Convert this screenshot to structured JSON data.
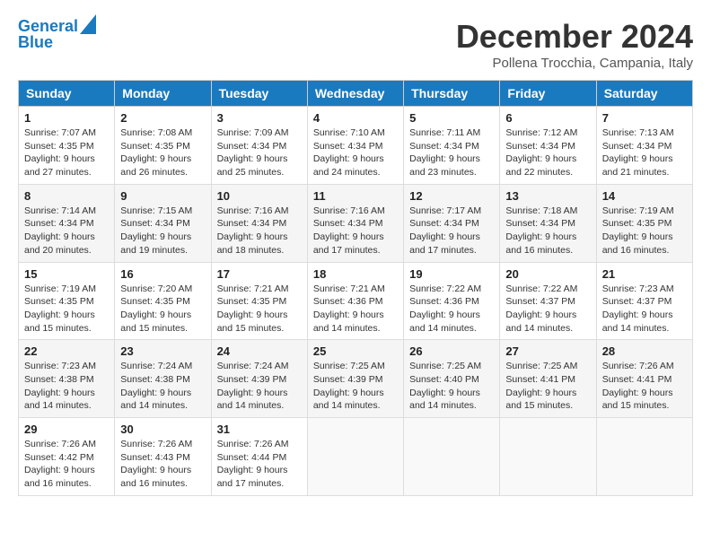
{
  "header": {
    "logo_line1": "General",
    "logo_line2": "Blue",
    "title": "December 2024",
    "location": "Pollena Trocchia, Campania, Italy"
  },
  "days_of_week": [
    "Sunday",
    "Monday",
    "Tuesday",
    "Wednesday",
    "Thursday",
    "Friday",
    "Saturday"
  ],
  "weeks": [
    [
      {
        "day": 1,
        "sunrise": "7:07 AM",
        "sunset": "4:35 PM",
        "daylight": "9 hours and 27 minutes."
      },
      {
        "day": 2,
        "sunrise": "7:08 AM",
        "sunset": "4:35 PM",
        "daylight": "9 hours and 26 minutes."
      },
      {
        "day": 3,
        "sunrise": "7:09 AM",
        "sunset": "4:34 PM",
        "daylight": "9 hours and 25 minutes."
      },
      {
        "day": 4,
        "sunrise": "7:10 AM",
        "sunset": "4:34 PM",
        "daylight": "9 hours and 24 minutes."
      },
      {
        "day": 5,
        "sunrise": "7:11 AM",
        "sunset": "4:34 PM",
        "daylight": "9 hours and 23 minutes."
      },
      {
        "day": 6,
        "sunrise": "7:12 AM",
        "sunset": "4:34 PM",
        "daylight": "9 hours and 22 minutes."
      },
      {
        "day": 7,
        "sunrise": "7:13 AM",
        "sunset": "4:34 PM",
        "daylight": "9 hours and 21 minutes."
      }
    ],
    [
      {
        "day": 8,
        "sunrise": "7:14 AM",
        "sunset": "4:34 PM",
        "daylight": "9 hours and 20 minutes."
      },
      {
        "day": 9,
        "sunrise": "7:15 AM",
        "sunset": "4:34 PM",
        "daylight": "9 hours and 19 minutes."
      },
      {
        "day": 10,
        "sunrise": "7:16 AM",
        "sunset": "4:34 PM",
        "daylight": "9 hours and 18 minutes."
      },
      {
        "day": 11,
        "sunrise": "7:16 AM",
        "sunset": "4:34 PM",
        "daylight": "9 hours and 17 minutes."
      },
      {
        "day": 12,
        "sunrise": "7:17 AM",
        "sunset": "4:34 PM",
        "daylight": "9 hours and 17 minutes."
      },
      {
        "day": 13,
        "sunrise": "7:18 AM",
        "sunset": "4:34 PM",
        "daylight": "9 hours and 16 minutes."
      },
      {
        "day": 14,
        "sunrise": "7:19 AM",
        "sunset": "4:35 PM",
        "daylight": "9 hours and 16 minutes."
      }
    ],
    [
      {
        "day": 15,
        "sunrise": "7:19 AM",
        "sunset": "4:35 PM",
        "daylight": "9 hours and 15 minutes."
      },
      {
        "day": 16,
        "sunrise": "7:20 AM",
        "sunset": "4:35 PM",
        "daylight": "9 hours and 15 minutes."
      },
      {
        "day": 17,
        "sunrise": "7:21 AM",
        "sunset": "4:35 PM",
        "daylight": "9 hours and 15 minutes."
      },
      {
        "day": 18,
        "sunrise": "7:21 AM",
        "sunset": "4:36 PM",
        "daylight": "9 hours and 14 minutes."
      },
      {
        "day": 19,
        "sunrise": "7:22 AM",
        "sunset": "4:36 PM",
        "daylight": "9 hours and 14 minutes."
      },
      {
        "day": 20,
        "sunrise": "7:22 AM",
        "sunset": "4:37 PM",
        "daylight": "9 hours and 14 minutes."
      },
      {
        "day": 21,
        "sunrise": "7:23 AM",
        "sunset": "4:37 PM",
        "daylight": "9 hours and 14 minutes."
      }
    ],
    [
      {
        "day": 22,
        "sunrise": "7:23 AM",
        "sunset": "4:38 PM",
        "daylight": "9 hours and 14 minutes."
      },
      {
        "day": 23,
        "sunrise": "7:24 AM",
        "sunset": "4:38 PM",
        "daylight": "9 hours and 14 minutes."
      },
      {
        "day": 24,
        "sunrise": "7:24 AM",
        "sunset": "4:39 PM",
        "daylight": "9 hours and 14 minutes."
      },
      {
        "day": 25,
        "sunrise": "7:25 AM",
        "sunset": "4:39 PM",
        "daylight": "9 hours and 14 minutes."
      },
      {
        "day": 26,
        "sunrise": "7:25 AM",
        "sunset": "4:40 PM",
        "daylight": "9 hours and 14 minutes."
      },
      {
        "day": 27,
        "sunrise": "7:25 AM",
        "sunset": "4:41 PM",
        "daylight": "9 hours and 15 minutes."
      },
      {
        "day": 28,
        "sunrise": "7:26 AM",
        "sunset": "4:41 PM",
        "daylight": "9 hours and 15 minutes."
      }
    ],
    [
      {
        "day": 29,
        "sunrise": "7:26 AM",
        "sunset": "4:42 PM",
        "daylight": "9 hours and 16 minutes."
      },
      {
        "day": 30,
        "sunrise": "7:26 AM",
        "sunset": "4:43 PM",
        "daylight": "9 hours and 16 minutes."
      },
      {
        "day": 31,
        "sunrise": "7:26 AM",
        "sunset": "4:44 PM",
        "daylight": "9 hours and 17 minutes."
      },
      null,
      null,
      null,
      null
    ]
  ]
}
